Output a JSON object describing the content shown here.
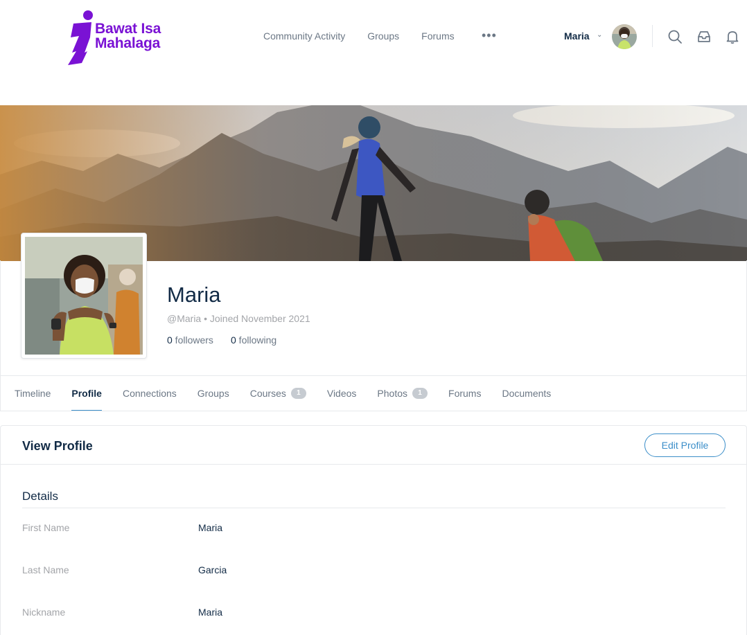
{
  "brand": {
    "line1": "Bawat Isa",
    "line2": "Mahalaga",
    "color": "#7a12d4"
  },
  "nav": {
    "items": [
      {
        "label": "Community Activity"
      },
      {
        "label": "Groups"
      },
      {
        "label": "Forums"
      }
    ],
    "more_label": "•••"
  },
  "user_menu": {
    "name": "Maria",
    "chevron": "⌄"
  },
  "icons": {
    "search": "search-icon",
    "inbox": "inbox-icon",
    "notifications": "bell-icon"
  },
  "profile": {
    "display_name": "Maria",
    "handle_line": "@Maria • Joined November 2021",
    "followers_count": "0",
    "followers_label": " followers",
    "following_count": "0",
    "following_label": " following"
  },
  "tabs": [
    {
      "label": "Timeline",
      "badge": ""
    },
    {
      "label": "Profile",
      "badge": ""
    },
    {
      "label": "Connections",
      "badge": ""
    },
    {
      "label": "Groups",
      "badge": ""
    },
    {
      "label": "Courses",
      "badge": "1"
    },
    {
      "label": "Videos",
      "badge": ""
    },
    {
      "label": "Photos",
      "badge": "1"
    },
    {
      "label": "Forums",
      "badge": ""
    },
    {
      "label": "Documents",
      "badge": ""
    }
  ],
  "view_profile": {
    "title": "View Profile",
    "edit_label": "Edit Profile",
    "section_title": "Details",
    "fields": [
      {
        "label": "First Name",
        "value": "Maria"
      },
      {
        "label": "Last Name",
        "value": "Garcia"
      },
      {
        "label": "Nickname",
        "value": "Maria"
      }
    ]
  },
  "colors": {
    "accent": "#3b8ec9",
    "heading": "#122b46",
    "muted": "#a3a5a9"
  }
}
